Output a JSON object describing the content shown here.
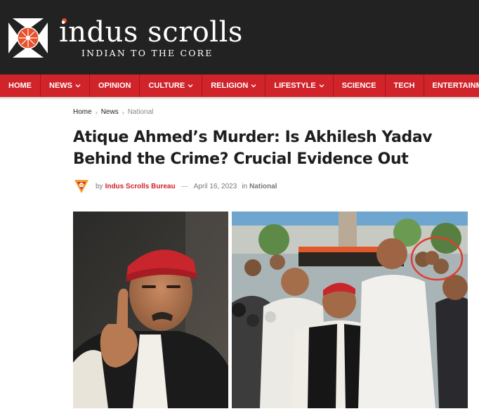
{
  "site": {
    "name": "indus scrolls",
    "tagline": "INDIAN TO THE CORE",
    "brand_color": "#d1232a",
    "accent_dot_color": "#e8512a"
  },
  "nav": {
    "items": [
      {
        "label": "HOME",
        "dropdown": false
      },
      {
        "label": "NEWS",
        "dropdown": true
      },
      {
        "label": "OPINION",
        "dropdown": false
      },
      {
        "label": "CULTURE",
        "dropdown": true
      },
      {
        "label": "RELIGION",
        "dropdown": true
      },
      {
        "label": "LIFESTYLE",
        "dropdown": true
      },
      {
        "label": "SCIENCE",
        "dropdown": false
      },
      {
        "label": "TECH",
        "dropdown": false
      },
      {
        "label": "ENTERTAINMENT",
        "dropdown": false
      }
    ]
  },
  "breadcrumb": {
    "home": "Home",
    "section": "News",
    "current": "National"
  },
  "article": {
    "title": "Atique Ahmed’s Murder: Is Akhilesh Yadav Behind the Crime? Crucial Evidence Out",
    "by_label": "by",
    "author": "Indus Scrolls Bureau",
    "dash": "—",
    "date": "April 16, 2023",
    "in_label": "in",
    "category": "National"
  }
}
